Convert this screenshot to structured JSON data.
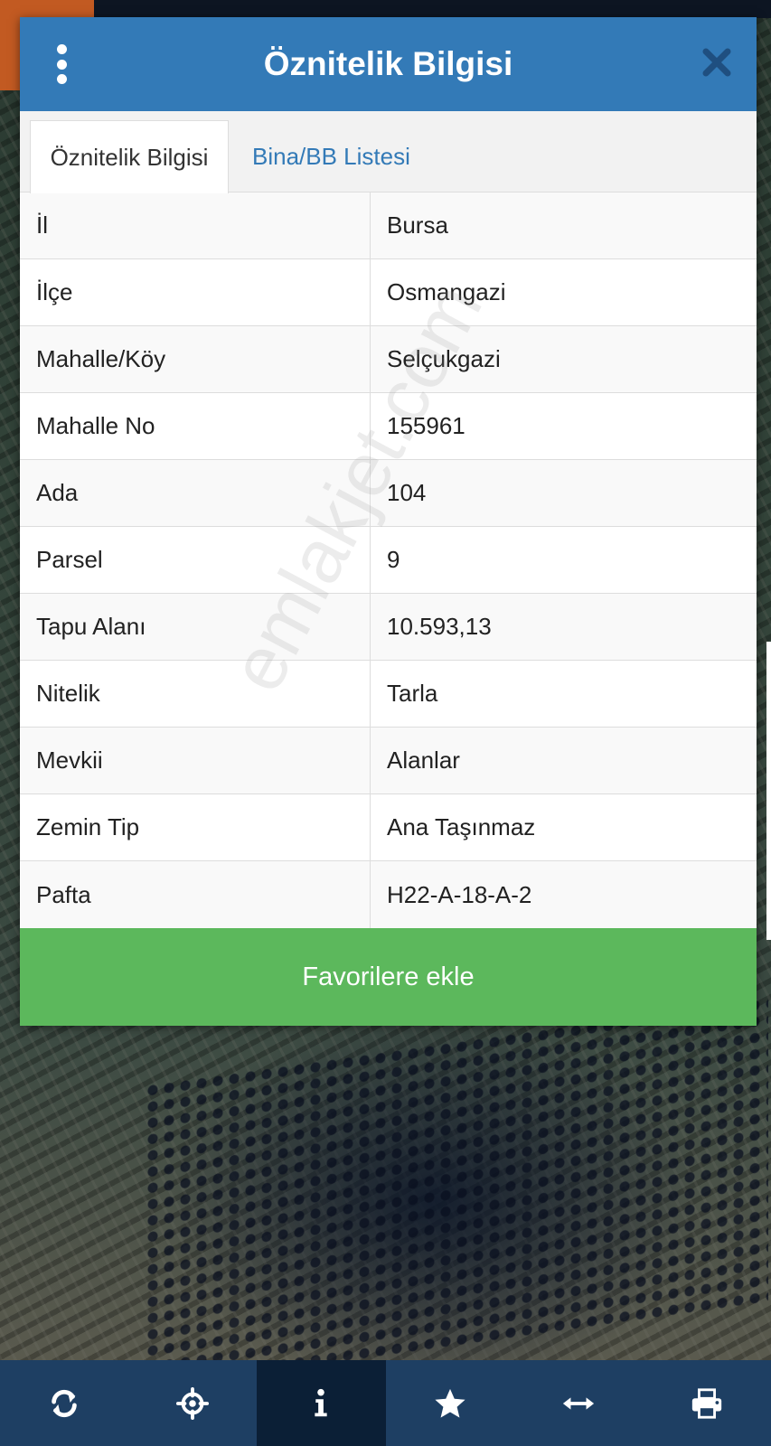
{
  "dialog": {
    "title": "Öznitelik Bilgisi",
    "menu_icon": "vertical-dots-icon",
    "close_icon": "close-icon"
  },
  "tabs": [
    {
      "label": "Öznitelik Bilgisi",
      "active": true
    },
    {
      "label": "Bina/BB Listesi",
      "active": false
    }
  ],
  "attributes": [
    {
      "label": "İl",
      "value": "Bursa"
    },
    {
      "label": "İlçe",
      "value": "Osmangazi"
    },
    {
      "label": "Mahalle/Köy",
      "value": "Selçukgazi"
    },
    {
      "label": "Mahalle No",
      "value": "155961"
    },
    {
      "label": "Ada",
      "value": "104"
    },
    {
      "label": "Parsel",
      "value": "9"
    },
    {
      "label": "Tapu Alanı",
      "value": "10.593,13"
    },
    {
      "label": "Nitelik",
      "value": "Tarla"
    },
    {
      "label": "Mevkii",
      "value": "Alanlar"
    },
    {
      "label": "Zemin Tip",
      "value": "Ana Taşınmaz"
    },
    {
      "label": "Pafta",
      "value": "H22-A-18-A-2"
    }
  ],
  "favorite_button": "Favorilere ekle",
  "watermark": "emlakjet.com",
  "toolbar": {
    "items": [
      {
        "icon": "refresh-icon"
      },
      {
        "icon": "crosshair-icon"
      },
      {
        "icon": "info-icon",
        "active": true
      },
      {
        "icon": "star-icon"
      },
      {
        "icon": "horizontal-arrows-icon"
      },
      {
        "icon": "printer-icon"
      }
    ]
  },
  "colors": {
    "header": "#337ab7",
    "button": "#5cb85c",
    "toolbar": "#1e3f63",
    "toolbar_active": "#0b1f36"
  }
}
